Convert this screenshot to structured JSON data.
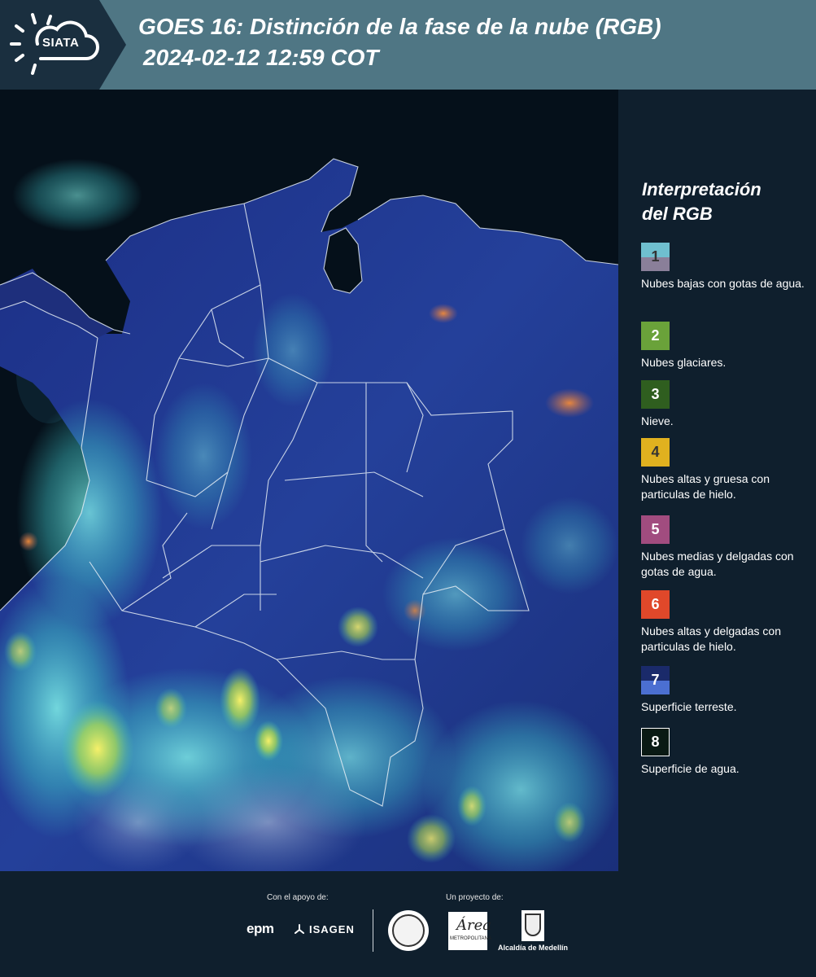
{
  "header": {
    "logo_text": "SIATA",
    "title_line1": "GOES 16: Distinción de la fase de la nube (RGB)",
    "title_line2": "2024-02-12 12:59 COT"
  },
  "legend": {
    "title_line1": "Interpretación",
    "title_line2": "del RGB",
    "items": [
      {
        "number": "1",
        "label": "Nubes bajas con gotas de agua.",
        "color_top": "#6fbfcf",
        "color_bottom": "#8a7f99"
      },
      {
        "number": "2",
        "label": "Nubes glaciares.",
        "color_top": "#6aa23a",
        "color_bottom": "#6aa23a"
      },
      {
        "number": "3",
        "label": "Nieve.",
        "color_top": "#2f5e1f",
        "color_bottom": "#2f5e1f"
      },
      {
        "number": "4",
        "label": "Nubes altas y gruesa con particulas de hielo.",
        "color_top": "#e0b11f",
        "color_bottom": "#e0b11f"
      },
      {
        "number": "5",
        "label": "Nubes medias y delgadas con gotas de agua.",
        "color_top": "#a14c7f",
        "color_bottom": "#a14c7f"
      },
      {
        "number": "6",
        "label": "Nubes altas y delgadas con particulas de hielo.",
        "color_top": "#e0482a",
        "color_bottom": "#e0482a"
      },
      {
        "number": "7",
        "label": "Superficie terreste.",
        "color_top": "#1a2a6a",
        "color_bottom": "#4b6fd1"
      },
      {
        "number": "8",
        "label": "Superficie de agua.",
        "color_top": "#0a1a14",
        "color_bottom": "#0a1a14"
      }
    ]
  },
  "footer": {
    "support_label": "Con el apoyo de:",
    "project_label": "Un proyecto de:",
    "epm": "epm",
    "isagen": "ISAGEN",
    "area_logo_text": "Área",
    "area_logo_sub": "METROPOLITANA",
    "medellin": "Alcaldía de Medellín"
  },
  "colors": {
    "header_bg": "#4f7684",
    "page_bg": "#0f1f2d",
    "land": "#1f3a8f",
    "water": "#05101a",
    "cloud_cyan": "#5fe0e0",
    "cloud_yellow": "#e8e06a"
  }
}
